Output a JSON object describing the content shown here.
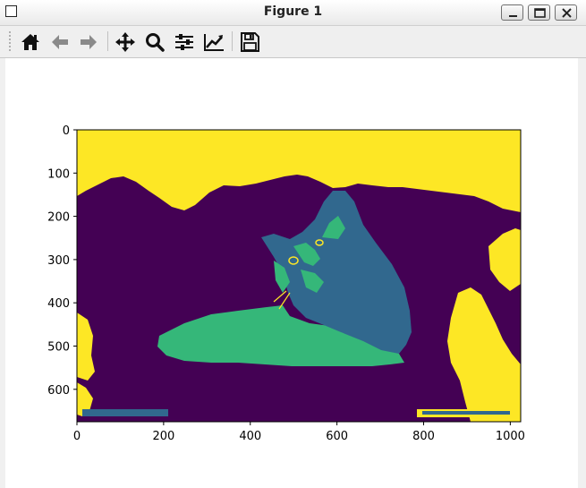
{
  "window": {
    "title": "Figure 1",
    "controls": [
      "minimize",
      "maximize",
      "close"
    ]
  },
  "toolbar": {
    "buttons": [
      {
        "name": "home",
        "icon": "home-icon"
      },
      {
        "name": "back",
        "icon": "arrow-left-icon"
      },
      {
        "name": "forward",
        "icon": "arrow-right-icon"
      },
      {
        "name": "pan",
        "icon": "move-icon"
      },
      {
        "name": "zoom",
        "icon": "magnifier-icon"
      },
      {
        "name": "configure-subplots",
        "icon": "sliders-icon"
      },
      {
        "name": "edit-axis",
        "icon": "line-chart-icon"
      },
      {
        "name": "save",
        "icon": "floppy-disk-icon"
      }
    ]
  },
  "figure": {
    "x_ticks": [
      "0",
      "200",
      "400",
      "600",
      "800",
      "1000"
    ],
    "y_ticks": [
      "0",
      "100",
      "200",
      "300",
      "400",
      "500",
      "600"
    ],
    "x_range": [
      0,
      1024
    ],
    "y_range": [
      0,
      675
    ],
    "image_content": "cat lying down, rendered with viridis colormap in 4 levels",
    "colors": {
      "level0": "#440154",
      "level1": "#31688e",
      "level2": "#35b779",
      "level3": "#fde725"
    }
  }
}
